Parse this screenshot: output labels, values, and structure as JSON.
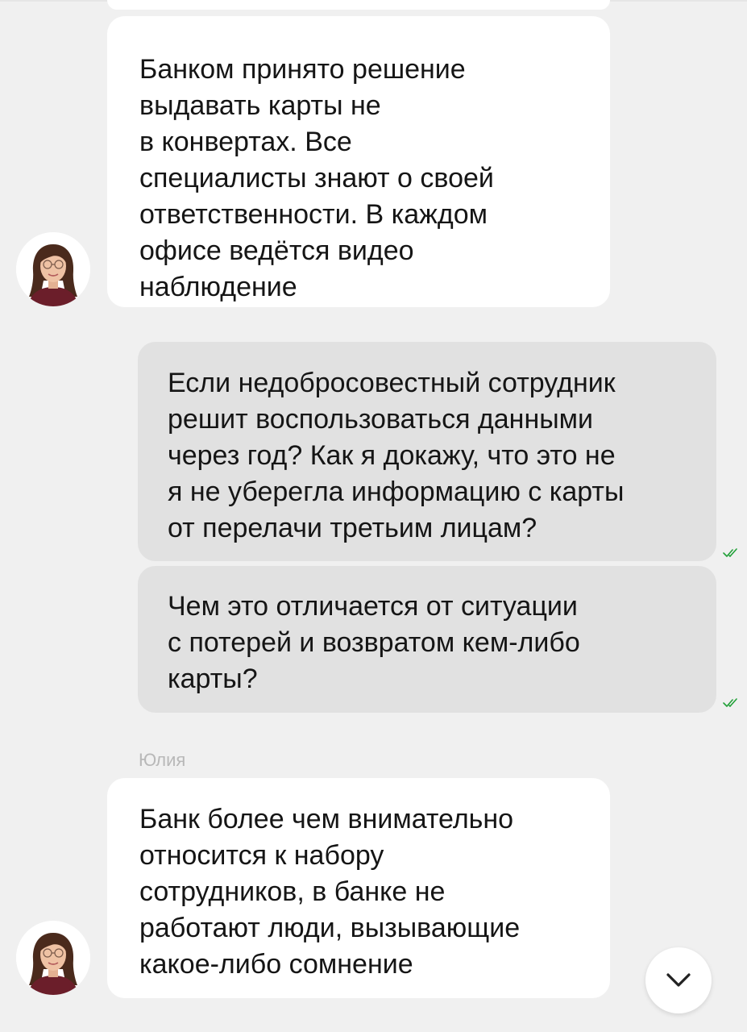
{
  "messages": [
    {
      "direction": "incoming",
      "text": "Банком принято решение\nвыдавать карты не\nв конвертах. Все\nспециалисты знают о своей\nответственности. В каждом\nофисе ведётся видео\nнаблюдение"
    },
    {
      "direction": "outgoing",
      "text": "Если недобросовестный сотрудник\nрешит воспользоваться данными\nчерез год? Как я докажу, что это не\nя не уберегла информацию с карты\nот перелачи третьим лицам?",
      "status": "read"
    },
    {
      "direction": "outgoing",
      "text": "Чем это отличается от ситуации\nс потерей и возвратом кем-либо\nкарты?",
      "status": "read"
    },
    {
      "direction": "incoming",
      "sender": "Юлия",
      "text": "Банк более чем внимательно\nотносится к набору\nсотрудников, в банке не\nработают люди, вызывающие\nкакое-либо сомнение"
    }
  ],
  "icons": {
    "read_receipt": "double-check-icon",
    "scroll_down": "chevron-down-icon",
    "avatar": "user-avatar"
  },
  "colors": {
    "background": "#f0f0f0",
    "incoming_bubble": "#ffffff",
    "outgoing_bubble": "#e1e1e1",
    "read_check": "#21a038",
    "sender_name": "#b8b8b8"
  }
}
